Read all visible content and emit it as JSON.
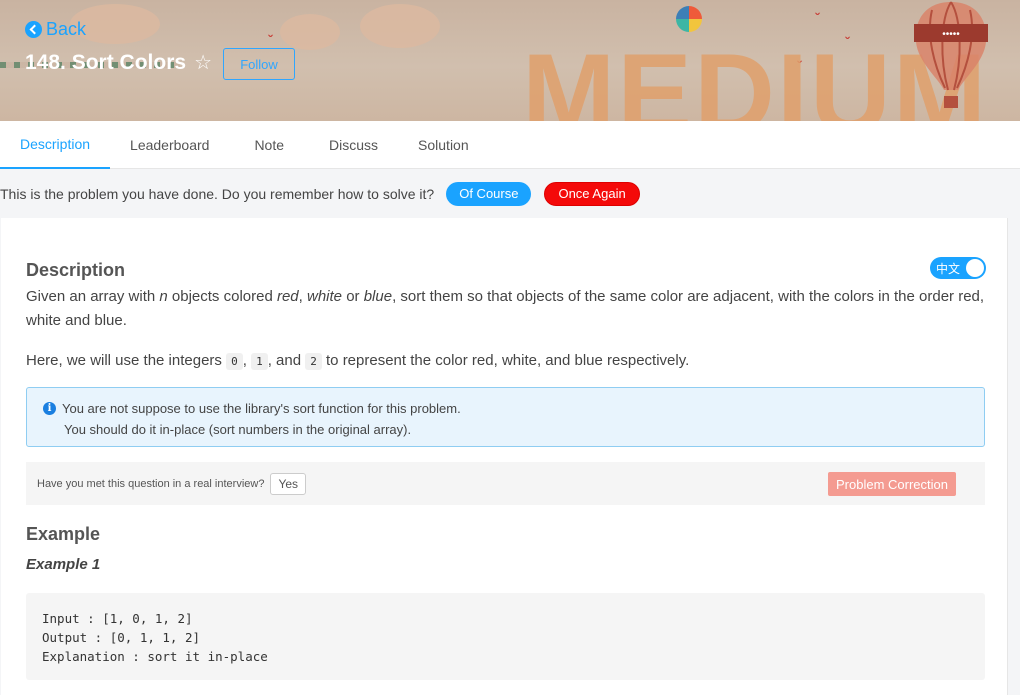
{
  "banner": {
    "back_label": "Back",
    "title": "148. Sort Colors",
    "follow_label": "Follow",
    "difficulty_word": "MEDIUM",
    "balloon_text": "•••••"
  },
  "tabs": [
    {
      "label": "Description",
      "active": true
    },
    {
      "label": "Leaderboard",
      "active": false
    },
    {
      "label": "Note",
      "active": false
    },
    {
      "label": "Discuss",
      "active": false
    },
    {
      "label": "Solution",
      "active": false
    }
  ],
  "done_bar": {
    "message": "This is the problem you have done. Do you remember how to solve it?",
    "of_course_label": "Of Course",
    "once_again_label": "Once Again"
  },
  "description": {
    "heading": "Description",
    "lang_toggle": "中文",
    "p1_a": "Given an array with ",
    "p1_n": "n",
    "p1_b": " objects colored ",
    "p1_red": "red",
    "p1_c": ", ",
    "p1_white": "white",
    "p1_d": " or ",
    "p1_blue": "blue",
    "p1_e": ", sort them so that objects of the same color are adjacent, with the colors in the order red, white and blue.",
    "p2_a": "Here, we will use the integers ",
    "code0": "0",
    "p2_sep1": ", ",
    "code1": "1",
    "p2_sep2": ", and ",
    "code2": "2",
    "p2_b": " to represent the color red, white, and blue respectively.",
    "note_line1": "You are not suppose to use the library's sort function for this problem.",
    "note_line2": "You should do it in-place (sort numbers in the original array).",
    "interview_question": "Have you met this question in a real interview?",
    "yes_label": "Yes",
    "correction_label": "Problem Correction"
  },
  "example": {
    "heading": "Example",
    "sub_heading": "Example 1",
    "code": "Input : [1, 0, 1, 2]\nOutput : [0, 1, 1, 2]\nExplanation : sort it in-place"
  },
  "colors": {
    "accent": "#1aa3ff",
    "danger": "#f40a0a",
    "correction": "#f49b91",
    "note_bg": "#e8f4fd"
  }
}
